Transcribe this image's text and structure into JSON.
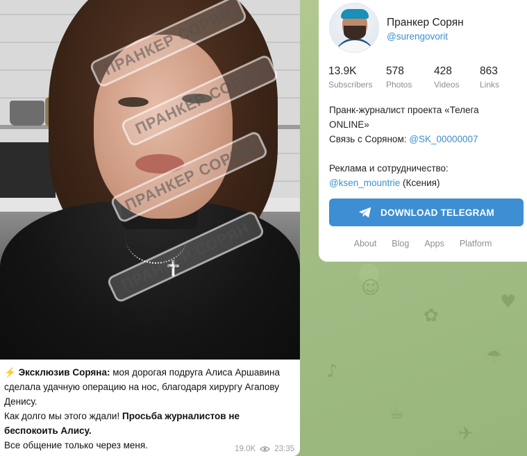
{
  "message": {
    "watermark_text": "ПРАНКЕР СОРЯН",
    "caption": {
      "emoji": "⚡",
      "lead_bold": "Эксклюзив Соряна:",
      "lead_rest": " моя дорогая подруга Алиса Аршавина сделала удачную операцию на нос, благодаря хирургу Агапову Денису.",
      "line2_plain": "Как долго мы этого ждали! ",
      "line2_bold": "Просьба журналистов не беспокоить Алису.",
      "line3": "Все общение только через меня."
    },
    "views": "19.0K",
    "time": "23:35"
  },
  "channel": {
    "name": "Пранкер Сорян",
    "handle": "@surengovorit",
    "stats": [
      {
        "value": "13.9K",
        "label": "Subscribers"
      },
      {
        "value": "578",
        "label": "Photos"
      },
      {
        "value": "428",
        "label": "Videos"
      },
      {
        "value": "863",
        "label": "Links"
      }
    ],
    "description": {
      "line1": "Пранк-журналист проекта «Телега ONLINE»",
      "contact_prefix": "Связь с Соряном: ",
      "contact_link": "@SK_00000007",
      "ads_label": "Реклама и сотрудничество:",
      "ads_link": "@ksen_mountrie",
      "ads_suffix": " (Ксения)"
    },
    "download_button": "DOWNLOAD TELEGRAM",
    "footer_links": [
      "About",
      "Blog",
      "Apps",
      "Platform"
    ]
  },
  "colors": {
    "accent": "#3d8ed3",
    "link": "#3a8fd1",
    "background": "#a9c28a"
  }
}
